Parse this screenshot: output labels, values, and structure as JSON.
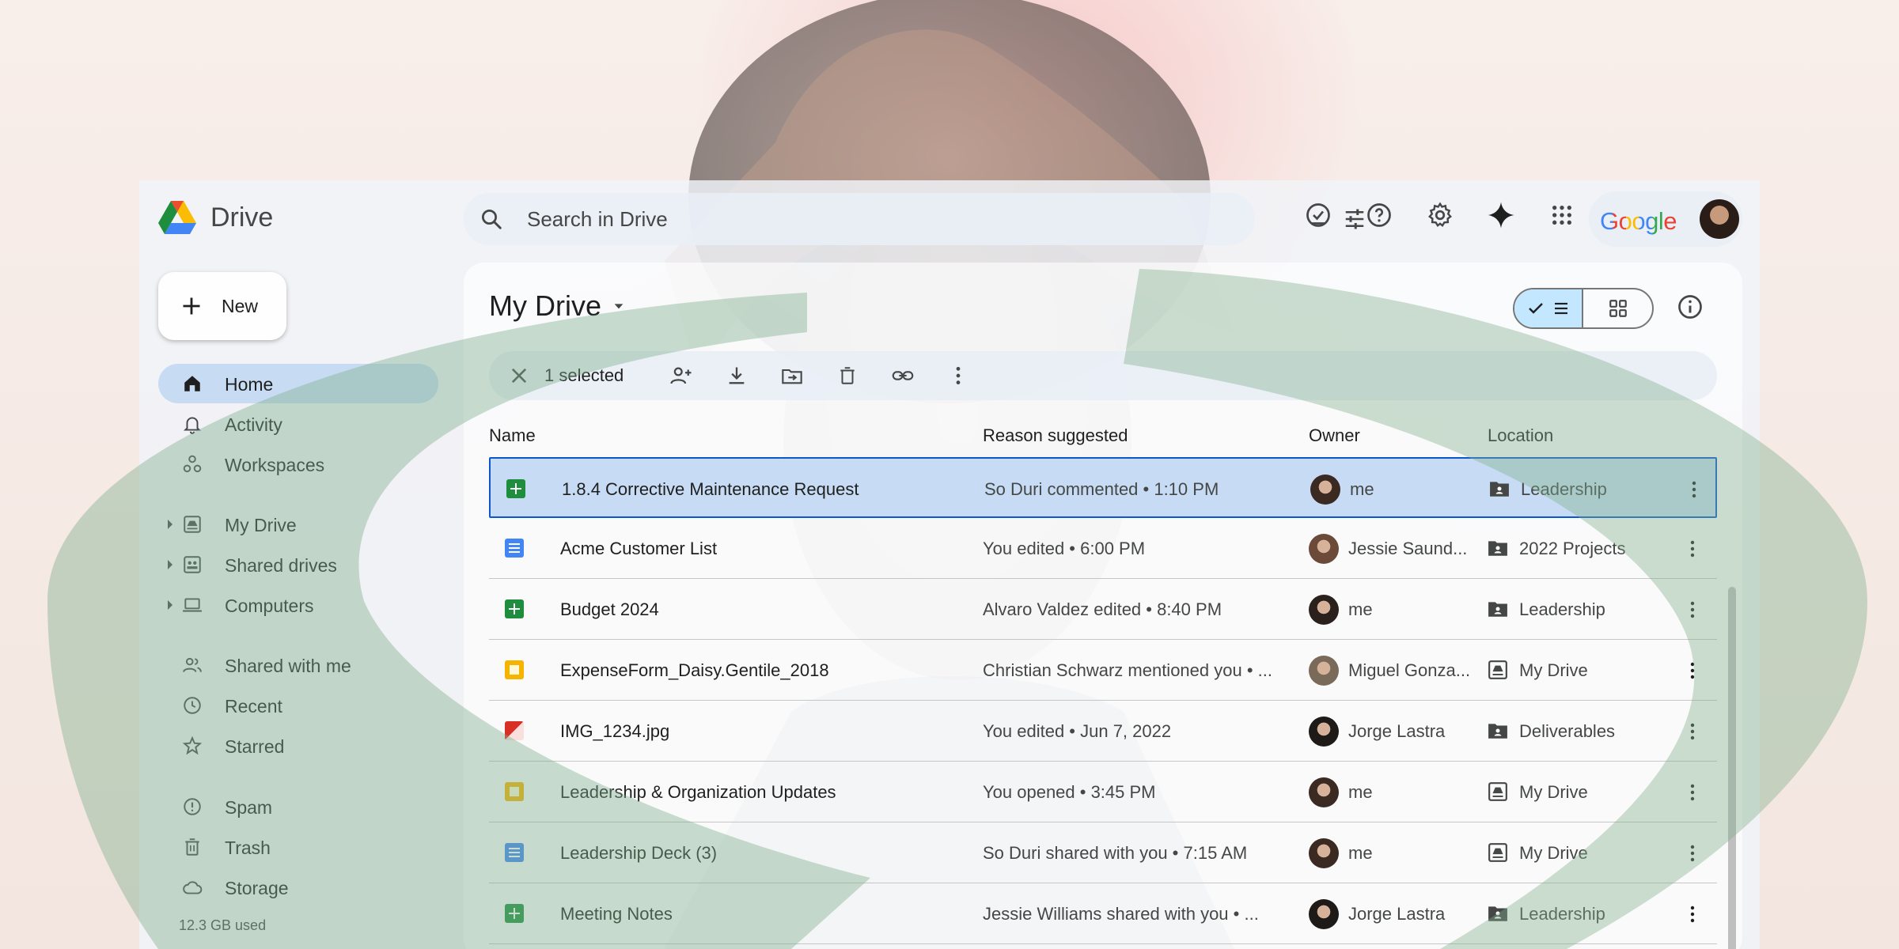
{
  "app": {
    "title": "Drive",
    "account_word": "Google"
  },
  "search": {
    "placeholder": "Search in Drive"
  },
  "top_icons": [
    "tasks-check-icon",
    "help-icon",
    "settings-icon",
    "gemini-sparkle-icon",
    "apps-grid-icon"
  ],
  "sidebar": {
    "new_label": "New",
    "items": [
      {
        "label": "Home",
        "icon": "home-icon",
        "active": true
      },
      {
        "label": "Activity",
        "icon": "bell-icon"
      },
      {
        "label": "Workspaces",
        "icon": "workspaces-icon"
      },
      {
        "label": "My Drive",
        "icon": "my-drive-icon",
        "expandable": true
      },
      {
        "label": "Shared drives",
        "icon": "shared-drives-icon",
        "expandable": true
      },
      {
        "label": "Computers",
        "icon": "computer-icon",
        "expandable": true
      },
      {
        "label": "Shared with me",
        "icon": "people-icon"
      },
      {
        "label": "Recent",
        "icon": "clock-icon"
      },
      {
        "label": "Starred",
        "icon": "star-icon"
      },
      {
        "label": "Spam",
        "icon": "spam-icon"
      },
      {
        "label": "Trash",
        "icon": "trash-icon"
      },
      {
        "label": "Storage",
        "icon": "cloud-icon"
      }
    ],
    "storage_used": "12.3 GB used"
  },
  "main": {
    "title": "My Drive",
    "selection": {
      "count_label": "1 selected"
    },
    "columns": {
      "name": "Name",
      "reason": "Reason suggested",
      "owner": "Owner",
      "location": "Location"
    },
    "rows": [
      {
        "type": "sheet",
        "name": "1.8.4 Corrective Maintenance Request",
        "reason": "So Duri commented • 1:10 PM",
        "owner": "me",
        "location": "Leadership",
        "location_type": "shared-folder",
        "selected": true
      },
      {
        "type": "doc",
        "name": "Acme Customer List",
        "reason": "You edited • 6:00 PM",
        "owner": "Jessie Saund...",
        "location": "2022 Projects",
        "location_type": "shared-folder"
      },
      {
        "type": "sheet",
        "name": "Budget 2024",
        "reason": "Alvaro Valdez edited • 8:40 PM",
        "owner": "me",
        "location": "Leadership",
        "location_type": "shared-folder"
      },
      {
        "type": "slides",
        "name": "ExpenseForm_Daisy.Gentile_2018",
        "reason": "Christian Schwarz mentioned you • ...",
        "owner": "Miguel Gonza...",
        "location": "My Drive",
        "location_type": "drive"
      },
      {
        "type": "image",
        "name": "IMG_1234.jpg",
        "reason": "You edited • Jun 7, 2022",
        "owner": "Jorge Lastra",
        "location": "Deliverables",
        "location_type": "shared-folder"
      },
      {
        "type": "slides",
        "name": "Leadership & Organization Updates",
        "reason": "You opened • 3:45 PM",
        "owner": "me",
        "location": "My Drive",
        "location_type": "drive"
      },
      {
        "type": "doc",
        "name": "Leadership Deck (3)",
        "reason": "So Duri shared with you • 7:15 AM",
        "owner": "me",
        "location": "My Drive",
        "location_type": "drive"
      },
      {
        "type": "sheet",
        "name": "Meeting Notes",
        "reason": "Jessie Williams shared with you • ...",
        "owner": "Jorge Lastra",
        "location": "Leadership",
        "location_type": "shared-folder"
      }
    ]
  },
  "colors": {
    "sheet": "#1e8e3e",
    "doc": "#4285f4",
    "slides": "#f4b400",
    "image": "#d93025",
    "selection_fill": "#c2d9f3",
    "selection_border": "#0b57d0",
    "accent_arc": "#7fae8c"
  }
}
